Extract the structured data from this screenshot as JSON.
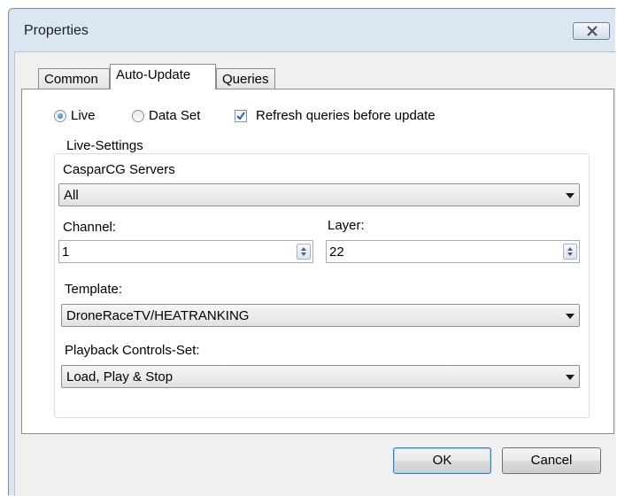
{
  "window": {
    "title": "Properties"
  },
  "tabs": [
    {
      "label": "Common",
      "active": false
    },
    {
      "label": "Auto-Update",
      "active": true
    },
    {
      "label": "Queries",
      "active": false
    }
  ],
  "mode": {
    "live_label": "Live",
    "live_selected": true,
    "dataset_label": "Data Set",
    "dataset_selected": false,
    "refresh_label": "Refresh queries before update",
    "refresh_checked": true
  },
  "live_settings": {
    "group_title": "Live-Settings",
    "servers_label": "CasparCG Servers",
    "servers_value": "All",
    "channel_label": "Channel:",
    "channel_value": "1",
    "layer_label": "Layer:",
    "layer_value": "22",
    "template_label": "Template:",
    "template_value": "DroneRaceTV/HEATRANKING",
    "playback_label": "Playback Controls-Set:",
    "playback_value": "Load, Play & Stop"
  },
  "buttons": {
    "ok": "OK",
    "cancel": "Cancel"
  },
  "colors": {
    "accent": "#1a62c0",
    "check": "#2a5fb0",
    "frame": "#dbe6f3"
  }
}
